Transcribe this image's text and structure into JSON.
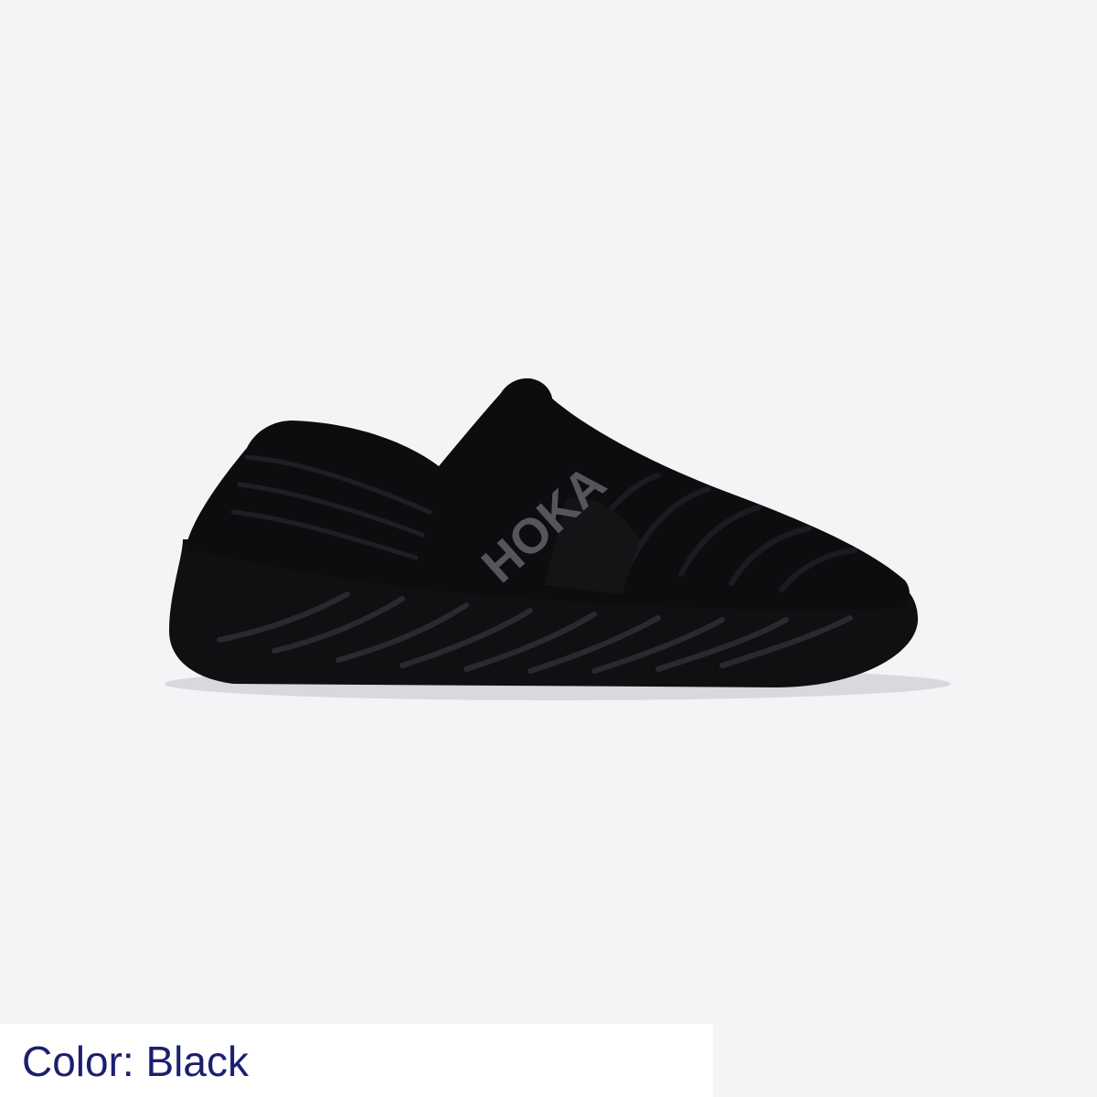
{
  "product": {
    "image_subject": "black slip-on shoe",
    "logo_text": "HOKA",
    "colors": {
      "background": "#f4f4f6",
      "shoe": "#0d0d0f",
      "logo": "#55565c",
      "caption_text": "#1c1f6e"
    }
  },
  "caption": {
    "text": "Color: Black"
  }
}
